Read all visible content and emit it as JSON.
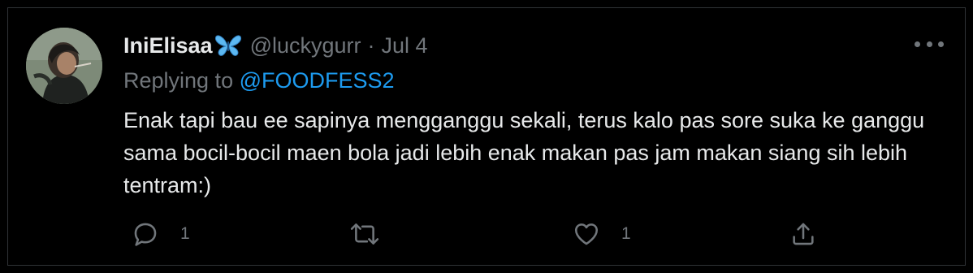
{
  "tweet": {
    "display_name": "IniElisaa",
    "handle": "@luckygurr",
    "separator": "·",
    "date": "Jul 4",
    "replying_prefix": "Replying to",
    "replying_to": "@FOODFESS2",
    "text": "Enak tapi bau ee sapinya mengganggu sekali, terus kalo pas sore suka ke ganggu sama bocil-bocil maen bola jadi lebih enak makan pas jam makan siang sih lebih tentram:)",
    "reply_count": "1",
    "like_count": "1"
  },
  "icons": {
    "name_emoji": "butterfly-icon",
    "more": "more-horizontal-icon",
    "reply": "reply-icon",
    "retweet": "retweet-icon",
    "like": "heart-icon",
    "share": "share-icon"
  },
  "colors": {
    "background": "#000000",
    "text": "#e7e9ea",
    "muted": "#71767b",
    "link": "#1d9bf0",
    "border": "#2f3336",
    "butterfly": "#5cb8f2"
  }
}
